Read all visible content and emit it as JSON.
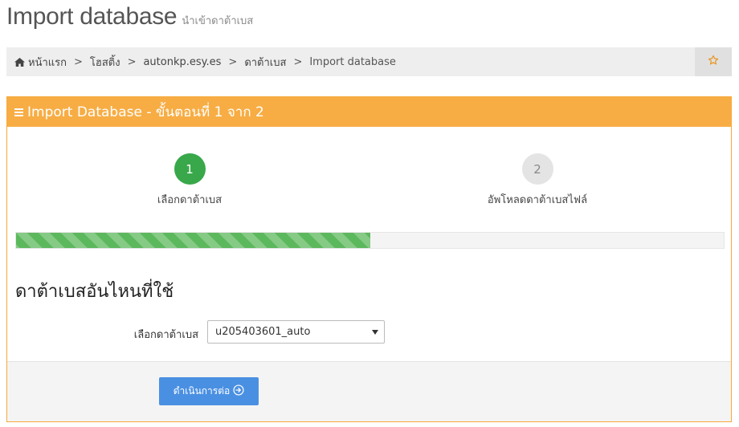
{
  "header": {
    "title": "Import database",
    "subtitle": "นำเข้าดาต้าเบส"
  },
  "breadcrumb": {
    "home_icon": "home-icon",
    "items": [
      "หน้าแรก",
      "โฮสติ้ง",
      "autonkp.esy.es",
      "ดาต้าเบส",
      "Import database"
    ],
    "favorite_icon": "star-outline-icon"
  },
  "panel": {
    "title": "Import Database - ขั้นตอนที่ 1 จาก 2",
    "accent_color": "#f7ad44"
  },
  "steps": [
    {
      "number": "1",
      "label": "เลือกดาต้าเบส",
      "state": "active",
      "color": "#38a84a"
    },
    {
      "number": "2",
      "label": "อัพโหลดดาต้าเบสไฟล์",
      "state": "inactive",
      "color": "#e4e4e4"
    }
  ],
  "progress": {
    "percent": 50,
    "color": "#5cb85c"
  },
  "section": {
    "title": "ดาต้าเบสอันไหนที่ใช้"
  },
  "form": {
    "database_label": "เลือกดาต้าเบส",
    "database_selected": "u205403601_auto"
  },
  "footer": {
    "continue_label": "ดำเนินการต่อ",
    "continue_icon": "arrow-right-circle-icon",
    "button_color": "#4a90e2"
  }
}
